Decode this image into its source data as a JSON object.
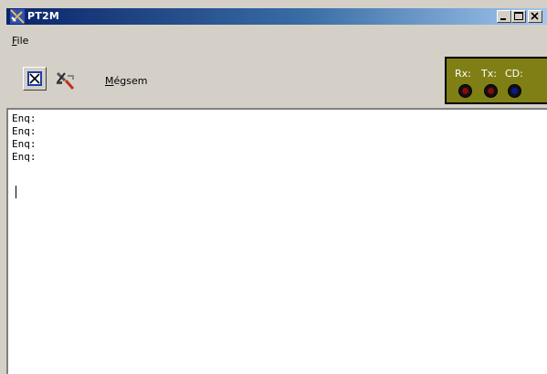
{
  "window": {
    "title": "PT2M",
    "caption_buttons": [
      "minimize",
      "maximize",
      "close"
    ]
  },
  "menu": {
    "file_accel": "F",
    "file_rest": "ile"
  },
  "toolbar": {
    "connect_icon": "terminal-connect-icon",
    "settings_icon": "tools-settings-icon",
    "cancel_accel": "M",
    "cancel_rest": "égsem"
  },
  "status_panel": {
    "rx_label": "Rx:",
    "tx_label": "Tx:",
    "cd_label": "CD:",
    "panel_color": "#7f7f16",
    "rx_led_color": "#8b0a0a",
    "tx_led_color": "#8b0a0a",
    "cd_led_color": "#0c1a8f"
  },
  "terminal": {
    "lines": [
      "Enq:",
      "Enq:",
      "Enq:",
      "Enq:"
    ]
  },
  "colors": {
    "titlebar_start": "#0a246a",
    "titlebar_end": "#a6caf0",
    "face": "#d4d0c8"
  }
}
